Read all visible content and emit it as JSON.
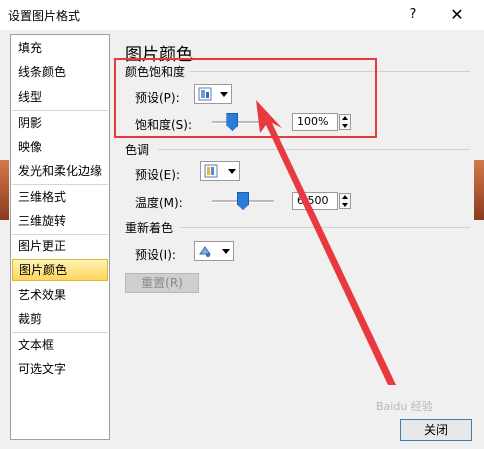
{
  "dialog": {
    "title": "设置图片格式",
    "help_label": "?",
    "close_glyph": "✕"
  },
  "sidebar": {
    "items": [
      {
        "label": "填充"
      },
      {
        "label": "线条颜色"
      },
      {
        "label": "线型"
      },
      {
        "label": "阴影"
      },
      {
        "label": "映像"
      },
      {
        "label": "发光和柔化边缘"
      },
      {
        "label": "三维格式"
      },
      {
        "label": "三维旋转"
      },
      {
        "label": "图片更正"
      },
      {
        "label": "图片颜色"
      },
      {
        "label": "艺术效果"
      },
      {
        "label": "裁剪"
      },
      {
        "label": "文本框"
      },
      {
        "label": "可选文字"
      }
    ],
    "selected": "图片颜色"
  },
  "main": {
    "heading": "图片颜色",
    "saturation": {
      "section": "颜色饱和度",
      "preset_label": "预设(P):",
      "amount_label": "饱和度(S):",
      "amount_value": "100%",
      "slider_level": 0.33
    },
    "tone": {
      "section": "色调",
      "preset_label": "预设(E):",
      "temp_label": "温度(M):",
      "temp_value": "6,500",
      "slider_level": 0.5
    },
    "recolor": {
      "section": "重新着色",
      "preset_label": "预设(I):",
      "reset_label": "重置(R)"
    }
  },
  "footer": {
    "close_label": "关闭"
  },
  "watermark": "Baidu 经验",
  "annotation_color": "#e8393f"
}
